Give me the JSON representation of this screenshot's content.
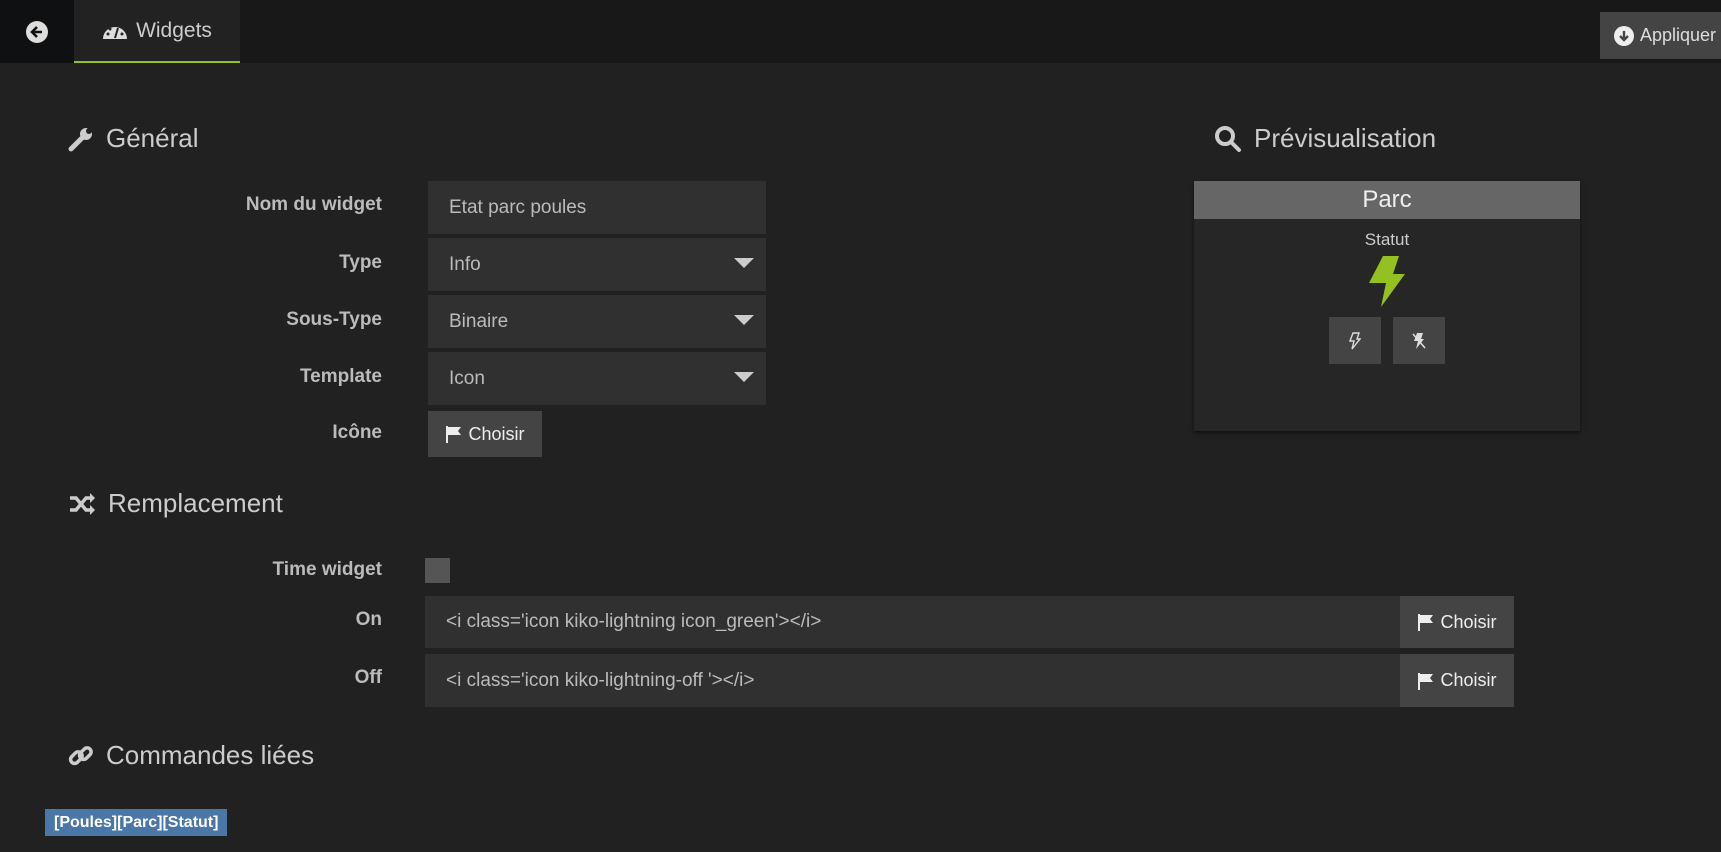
{
  "topbar": {
    "tab_label": "Widgets",
    "apply_label": "Appliquer"
  },
  "general": {
    "heading": "Général",
    "name_label": "Nom du widget",
    "name_value": "Etat parc poules",
    "type_label": "Type",
    "type_value": "Info",
    "subtype_label": "Sous-Type",
    "subtype_value": "Binaire",
    "template_label": "Template",
    "template_value": "Icon",
    "icon_label": "Icône",
    "icon_button": "Choisir"
  },
  "preview": {
    "heading": "Prévisualisation",
    "card_title": "Parc",
    "cmd_name": "Statut",
    "accent": "#94c121"
  },
  "replacement": {
    "heading": "Remplacement",
    "time_widget_label": "Time widget",
    "time_widget_checked": false,
    "on_label": "On",
    "on_value": "<i class='icon kiko-lightning icon_green'></i>",
    "on_button": "Choisir",
    "off_label": "Off",
    "off_value": "<i class='icon kiko-lightning-off '></i>",
    "off_button": "Choisir"
  },
  "linked": {
    "heading": "Commandes liées",
    "commands": [
      "[Poules][Parc][Statut]"
    ]
  }
}
